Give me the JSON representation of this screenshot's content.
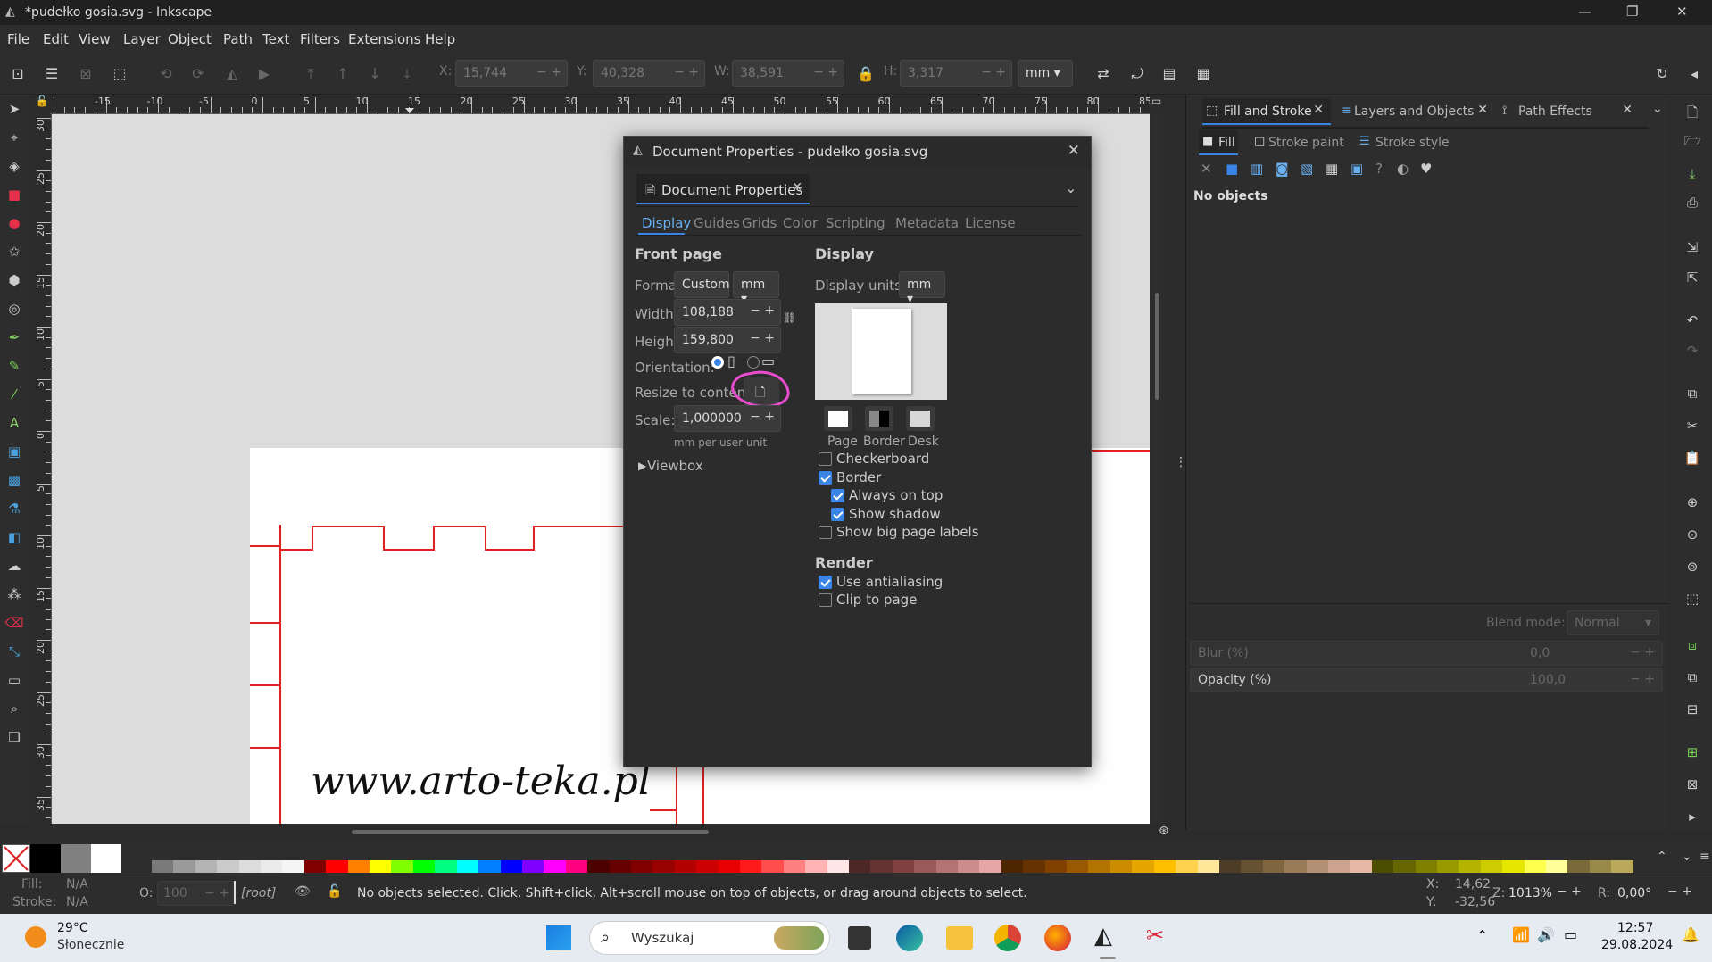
{
  "window": {
    "title": "*pudełko gosia.svg - Inkscape"
  },
  "menu": [
    "File",
    "Edit",
    "View",
    "Layer",
    "Object",
    "Path",
    "Text",
    "Filters",
    "Extensions",
    "Help"
  ],
  "toolbar": {
    "x_label": "X:",
    "x": "15,744",
    "y_label": "Y:",
    "y": "40,328",
    "w_label": "W:",
    "w": "38,591",
    "h_label": "H:",
    "h": "3,317",
    "unit": "mm"
  },
  "ruler_top": [
    "-15",
    "-10",
    "-5",
    "0",
    "5",
    "10",
    "15",
    "20",
    "25",
    "30",
    "35",
    "40",
    "45",
    "50",
    "55",
    "60",
    "65",
    "70",
    "75",
    "80",
    "85"
  ],
  "ruler_left": [
    "30",
    "25",
    "20",
    "15",
    "10",
    "5",
    "0",
    "5",
    "10",
    "15",
    "20",
    "25",
    "30",
    "35"
  ],
  "canvas": {
    "watermark": "www.arto-teka.pl"
  },
  "dialog": {
    "title": "Document Properties - pudełko gosia.svg",
    "tab_title": "Document Properties",
    "tabs": [
      "Display",
      "Guides",
      "Grids",
      "Color",
      "Scripting",
      "Metadata",
      "License"
    ],
    "front_page": "Front page",
    "format_label": "Format:",
    "format": "Custom",
    "format_unit": "mm",
    "width_label": "Width:",
    "width": "108,188",
    "height_label": "Height:",
    "height": "159,800",
    "orientation_label": "Orientation:",
    "resize_label": "Resize to content:",
    "scale_label": "Scale:",
    "scale": "1,000000",
    "scale_unit": "mm per user unit",
    "viewbox": "Viewbox",
    "display_heading": "Display",
    "display_units_label": "Display units:",
    "display_units": "mm",
    "swatches": [
      "Page",
      "Border",
      "Desk"
    ],
    "checkboxes": [
      {
        "label": "Checkerboard",
        "checked": false
      },
      {
        "label": "Border",
        "checked": true
      },
      {
        "label": "Always on top",
        "checked": true
      },
      {
        "label": "Show shadow",
        "checked": true
      },
      {
        "label": "Show big page labels",
        "checked": false
      }
    ],
    "render_heading": "Render",
    "render": [
      {
        "label": "Use antialiasing",
        "checked": true
      },
      {
        "label": "Clip to page",
        "checked": false
      }
    ]
  },
  "panel": {
    "tabs": [
      "Fill and Stroke",
      "Layers and Objects",
      "Path Effects"
    ],
    "subtabs": [
      "Fill",
      "Stroke paint",
      "Stroke style"
    ],
    "no_objects": "No objects",
    "blend_label": "Blend mode:",
    "blend": "Normal",
    "blur_label": "Blur (%)",
    "blur": "0,0",
    "opacity_label": "Opacity (%)",
    "opacity": "100,0"
  },
  "palette_colors": [
    "#7a7a7a",
    "#9a9a9a",
    "#b4b4b4",
    "#cacaca",
    "#dcdcdc",
    "#ebebeb",
    "#f5f5f5",
    "#800000",
    "#ff0000",
    "#ff8000",
    "#ffff00",
    "#80ff00",
    "#00ff00",
    "#00ff80",
    "#00ffff",
    "#0080ff",
    "#0000ff",
    "#8000ff",
    "#ff00ff",
    "#ff0080",
    "#4d0000",
    "#660000",
    "#800000",
    "#990000",
    "#b30000",
    "#cc0000",
    "#e60000",
    "#ff1a1a",
    "#ff4d4d",
    "#ff8080",
    "#ffb3b3",
    "#ffe6e6",
    "#4d2626",
    "#663333",
    "#804040",
    "#995959",
    "#b37373",
    "#cc8c8c",
    "#e6a6a6",
    "#4d2600",
    "#663300",
    "#804000",
    "#995900",
    "#b37300",
    "#cc8c00",
    "#e6a600",
    "#ffbf00",
    "#ffd24d",
    "#ffe699",
    "#4d3d26",
    "#665233",
    "#806640",
    "#997a59",
    "#b38f73",
    "#cca38c",
    "#e6b8a6",
    "#4d4d00",
    "#666600",
    "#808000",
    "#999900",
    "#b3b300",
    "#cccc00",
    "#e6e600",
    "#ffff4d",
    "#ffff99",
    "#7a6a3a",
    "#9a8a4a",
    "#baa95a"
  ],
  "status": {
    "fill_label": "Fill:",
    "fill": "N/A",
    "stroke_label": "Stroke:",
    "stroke": "N/A",
    "o_label": "O:",
    "o": "100",
    "layer": "[root]",
    "message": "No objects selected. Click, Shift+click, Alt+scroll mouse on top of objects, or drag around objects to select.",
    "x_label": "X:",
    "x": "14,62",
    "y_label": "Y:",
    "y": "-32,56",
    "z_label": "Z:",
    "zoom": "1013%",
    "r_label": "R:",
    "rotation": "0,00°"
  },
  "taskbar": {
    "temp": "29°C",
    "weather": "Słonecznie",
    "search": "Wyszukaj",
    "time": "12:57",
    "date": "29.08.2024"
  }
}
